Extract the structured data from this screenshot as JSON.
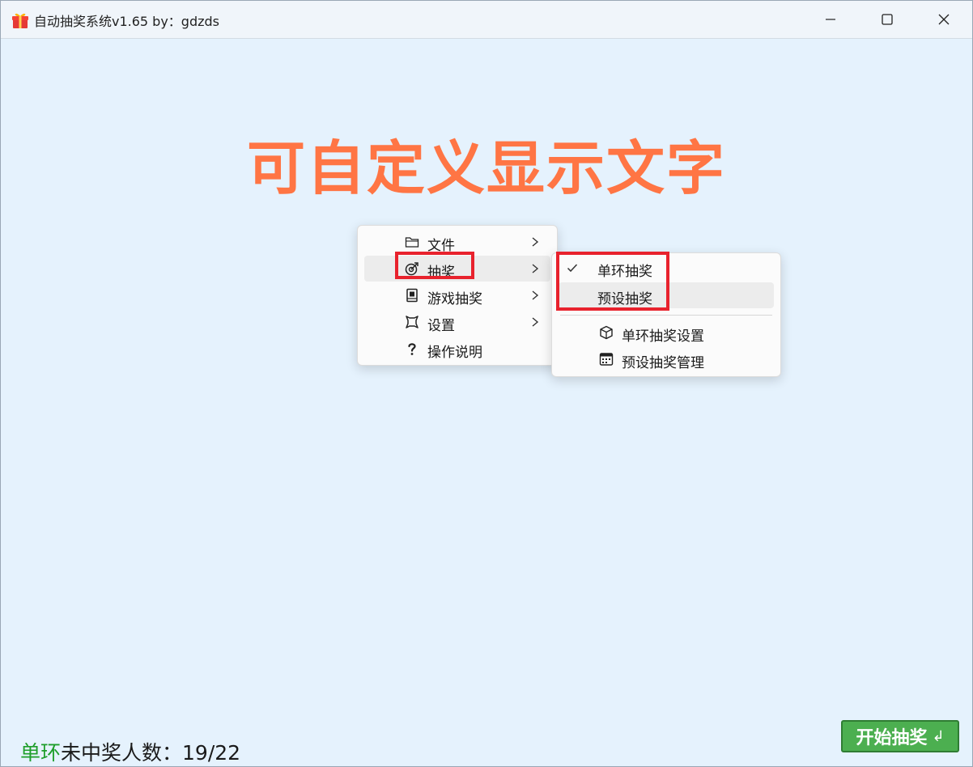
{
  "window": {
    "title": "自动抽奖系统v1.65 by：gdzds"
  },
  "display_text": "可自定义显示文字",
  "main_menu": {
    "items": [
      {
        "label": "文件",
        "icon": "folder-icon",
        "has_submenu": true
      },
      {
        "label": "抽奖",
        "icon": "lottery-icon",
        "has_submenu": true,
        "highlighted": true
      },
      {
        "label": "游戏抽奖",
        "icon": "game-icon",
        "has_submenu": true
      },
      {
        "label": "设置",
        "icon": "settings-icon",
        "has_submenu": true
      },
      {
        "label": "操作说明",
        "icon": "help-icon",
        "has_submenu": false
      }
    ]
  },
  "sub_menu": {
    "items": [
      {
        "label": "单环抽奖",
        "checked": true
      },
      {
        "label": "预设抽奖",
        "checked": false,
        "highlighted": true
      },
      {
        "label": "单环抽奖设置",
        "icon": "box-icon"
      },
      {
        "label": "预设抽奖管理",
        "icon": "calendar-icon"
      }
    ]
  },
  "status": {
    "mode": "单环",
    "text": "未中奖人数：19/22"
  },
  "start_button": {
    "label": "开始抽奖",
    "enter_glyph": "↲"
  },
  "colors": {
    "background": "#e5f2fd",
    "display_text": "#ff7544",
    "mode_text": "#1e9e2a",
    "start_button": "#4caf50",
    "highlight_box": "#e8222d"
  }
}
